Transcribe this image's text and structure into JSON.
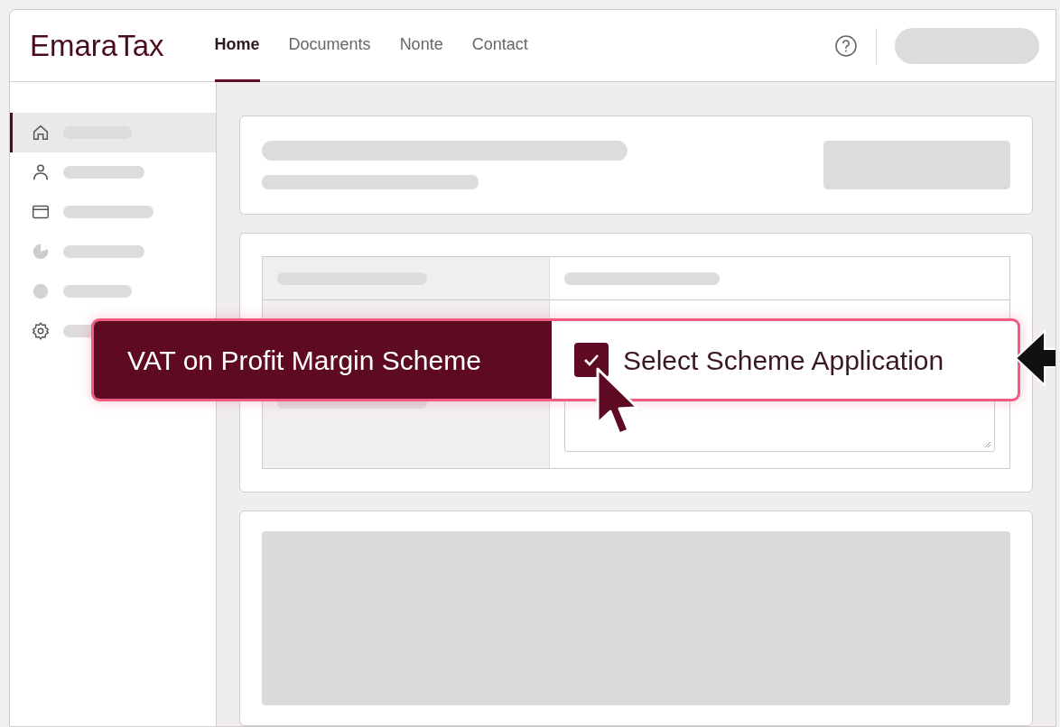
{
  "header": {
    "brand": "EmaraTax",
    "tabs": [
      {
        "label": "Home",
        "selected": true
      },
      {
        "label": "Documents",
        "selected": false
      },
      {
        "label": "Nonte",
        "selected": false
      },
      {
        "label": "Contact",
        "selected": false
      }
    ]
  },
  "sidebar": {
    "items": [
      {
        "kind": "home",
        "selected": true
      },
      {
        "kind": "person",
        "selected": false
      },
      {
        "kind": "card",
        "selected": false
      },
      {
        "kind": "pie",
        "selected": false
      },
      {
        "kind": "dot",
        "selected": false
      },
      {
        "kind": "gear",
        "selected": false
      }
    ]
  },
  "callout": {
    "title": "VAT on Profit Margin Scheme",
    "option": {
      "label": "Select Scheme Application",
      "checked": true
    }
  }
}
